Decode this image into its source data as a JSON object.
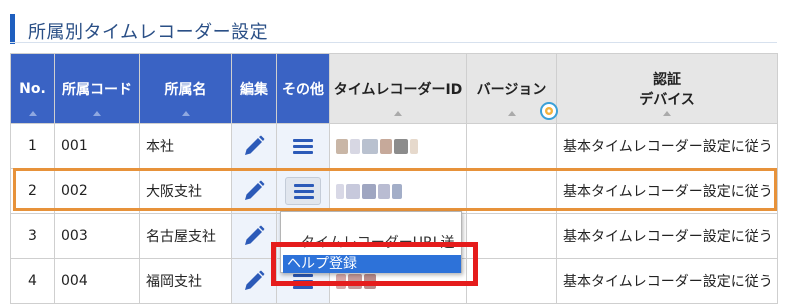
{
  "page": {
    "title": "所属別タイムレコーダー設定"
  },
  "columns": {
    "no": "No.",
    "code": "所属コード",
    "name": "所属名",
    "edit": "編集",
    "other": "その他",
    "tr_id": "タイムレコーダーID",
    "version": "バージョン",
    "auth_line1": "認証",
    "auth_line2": "デバイス"
  },
  "rows": [
    {
      "no": "1",
      "code": "001",
      "name": "本社",
      "auth": "基本タイムレコーダー設定に従う"
    },
    {
      "no": "2",
      "code": "002",
      "name": "大阪支社",
      "auth": "基本タイムレコーダー設定に従う"
    },
    {
      "no": "3",
      "code": "003",
      "name": "名古屋支社",
      "auth": "基本タイムレコーダー設定に従う"
    },
    {
      "no": "4",
      "code": "004",
      "name": "福岡支社",
      "auth": "基本タイムレコーダー設定に従う"
    }
  ],
  "context_menu": {
    "item1": "タイムレコーダーURL送信",
    "item2": "ヘルプ登録"
  },
  "icons": {
    "edit": "pencil-icon",
    "other": "hamburger-menu-icon",
    "version_badge": "gear-icon"
  },
  "colors": {
    "header_blue": "#3a63c4",
    "highlight_orange": "#e7923a",
    "annotation_red": "#e51c1c",
    "menu_selected": "#2d72d9"
  }
}
